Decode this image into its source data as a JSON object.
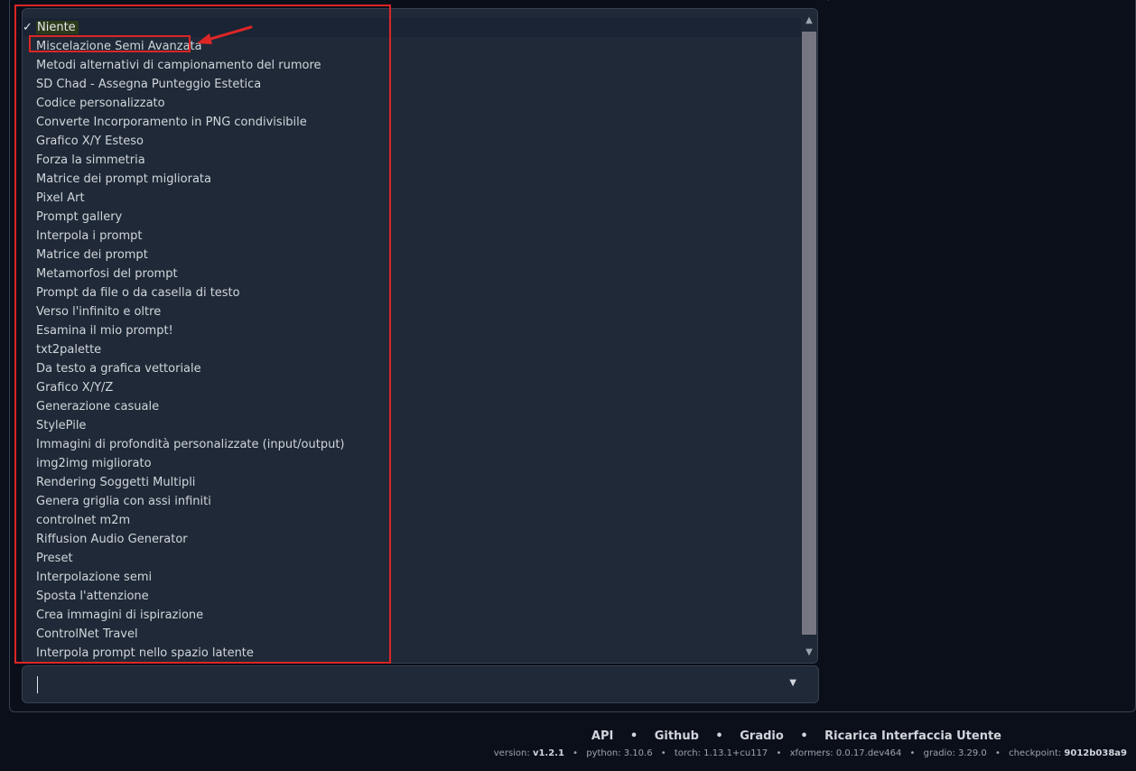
{
  "dropdown": {
    "selected_mark": "✓",
    "options": [
      "Niente",
      "Miscelazione Semi Avanzata",
      "Metodi alternativi di campionamento del rumore",
      "SD Chad - Assegna Punteggio Estetica",
      "Codice personalizzato",
      "Converte Incorporamento in PNG condivisibile",
      "Grafico X/Y Esteso",
      "Forza la simmetria",
      "Matrice dei prompt migliorata",
      "Pixel Art",
      "Prompt gallery",
      "Interpola i prompt",
      "Matrice dei prompt",
      "Metamorfosi del prompt",
      "Prompt da file o da casella di testo",
      "Verso l'infinito e oltre",
      "Esamina il mio prompt!",
      "txt2palette",
      "Da testo a grafica vettoriale",
      "Grafico X/Y/Z",
      "Generazione casuale",
      "StylePile",
      "Immagini di profondità personalizzate (input/output)",
      "img2img migliorato",
      "Rendering Soggetti Multipli",
      "Genera griglia con assi infiniti",
      "controlnet m2m",
      "Riffusion Audio Generator",
      "Preset",
      "Interpolazione semi",
      "Sposta l'attenzione",
      "Crea immagini di ispirazione",
      "ControlNet Travel",
      "Interpola prompt nello spazio latente"
    ]
  },
  "combo": {
    "value": "",
    "arrow_icon": "▼"
  },
  "footer": {
    "links": [
      "API",
      "Github",
      "Gradio",
      "Ricarica Interfaccia Utente"
    ],
    "separator": "•",
    "version_label": "version:",
    "version": "v1.2.1",
    "python": "python: 3.10.6",
    "torch": "torch: 1.13.1+cu117",
    "xformers": "xformers: 0.0.17.dev464",
    "gradio": "gradio: 3.29.0",
    "checkpoint_label": "checkpoint:",
    "checkpoint": "9012b038a9"
  },
  "colors": {
    "annotation": "#dc2626",
    "background": "#0b0f19",
    "panel": "#1f2937"
  }
}
